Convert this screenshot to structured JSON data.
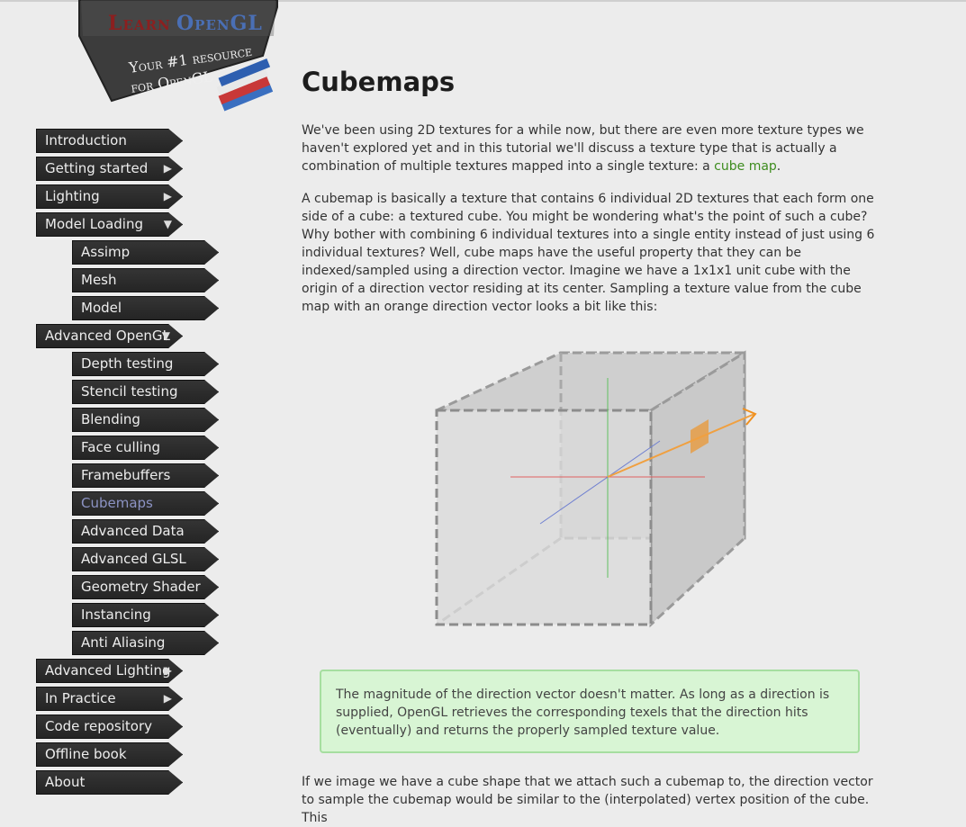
{
  "logo": {
    "learn": "Learn",
    "opengl": "OpenGL",
    "tagline_line1": "Your #1 resource",
    "tagline_line2": "for OpenGL"
  },
  "nav": {
    "items": [
      {
        "label": "Introduction",
        "arrow": ""
      },
      {
        "label": "Getting started",
        "arrow": "▶"
      },
      {
        "label": "Lighting",
        "arrow": "▶"
      },
      {
        "label": "Model Loading",
        "arrow": "▼"
      },
      {
        "label": "Assimp",
        "arrow": ""
      },
      {
        "label": "Mesh",
        "arrow": ""
      },
      {
        "label": "Model",
        "arrow": ""
      },
      {
        "label": "Advanced OpenGL",
        "arrow": "▼"
      },
      {
        "label": "Depth testing",
        "arrow": ""
      },
      {
        "label": "Stencil testing",
        "arrow": ""
      },
      {
        "label": "Blending",
        "arrow": ""
      },
      {
        "label": "Face culling",
        "arrow": ""
      },
      {
        "label": "Framebuffers",
        "arrow": ""
      },
      {
        "label": "Cubemaps",
        "arrow": ""
      },
      {
        "label": "Advanced Data",
        "arrow": ""
      },
      {
        "label": "Advanced GLSL",
        "arrow": ""
      },
      {
        "label": "Geometry Shader",
        "arrow": ""
      },
      {
        "label": "Instancing",
        "arrow": ""
      },
      {
        "label": "Anti Aliasing",
        "arrow": ""
      },
      {
        "label": "Advanced Lighting",
        "arrow": "▶"
      },
      {
        "label": "In Practice",
        "arrow": "▶"
      },
      {
        "label": "Code repository",
        "arrow": ""
      },
      {
        "label": "Offline book",
        "arrow": ""
      },
      {
        "label": "About",
        "arrow": ""
      }
    ],
    "active": "Cubemaps"
  },
  "content": {
    "title": "Cubemaps",
    "p1_before_link": "We've been using 2D textures for a while now, but there are even more texture types we haven't explored yet and in this tutorial we'll discuss a texture type that is actually a combination of multiple textures mapped into a single texture: a ",
    "p1_link": "cube map",
    "p1_after_link": ".",
    "p2": "A cubemap is basically a texture that contains 6 individual 2D textures that each form one side of a cube: a textured cube. You might be wondering what's the point of such a cube? Why bother with combining 6 individual textures into a single entity instead of just using 6 individual textures? Well, cube maps have the useful property that they can be indexed/sampled using a direction vector. Imagine we have a 1x1x1 unit cube with the origin of a direction vector residing at its center. Sampling a texture value from the cube map with an orange direction vector looks a bit like this:",
    "note": "The magnitude of the direction vector doesn't matter. As long as a direction is supplied, OpenGL retrieves the corresponding texels that the direction hits (eventually) and returns the properly sampled texture value.",
    "p3": "If we image we have a cube shape that we attach such a cubemap to, the direction vector to sample the cubemap would be similar to the (interpolated) vertex position of the cube. This"
  },
  "colors": {
    "link": "#3d8c1e",
    "active_nav": "#8c93c4",
    "note_bg": "#d8f5d4",
    "note_border": "#a6dea0",
    "direction_vector": "#f0901e"
  }
}
